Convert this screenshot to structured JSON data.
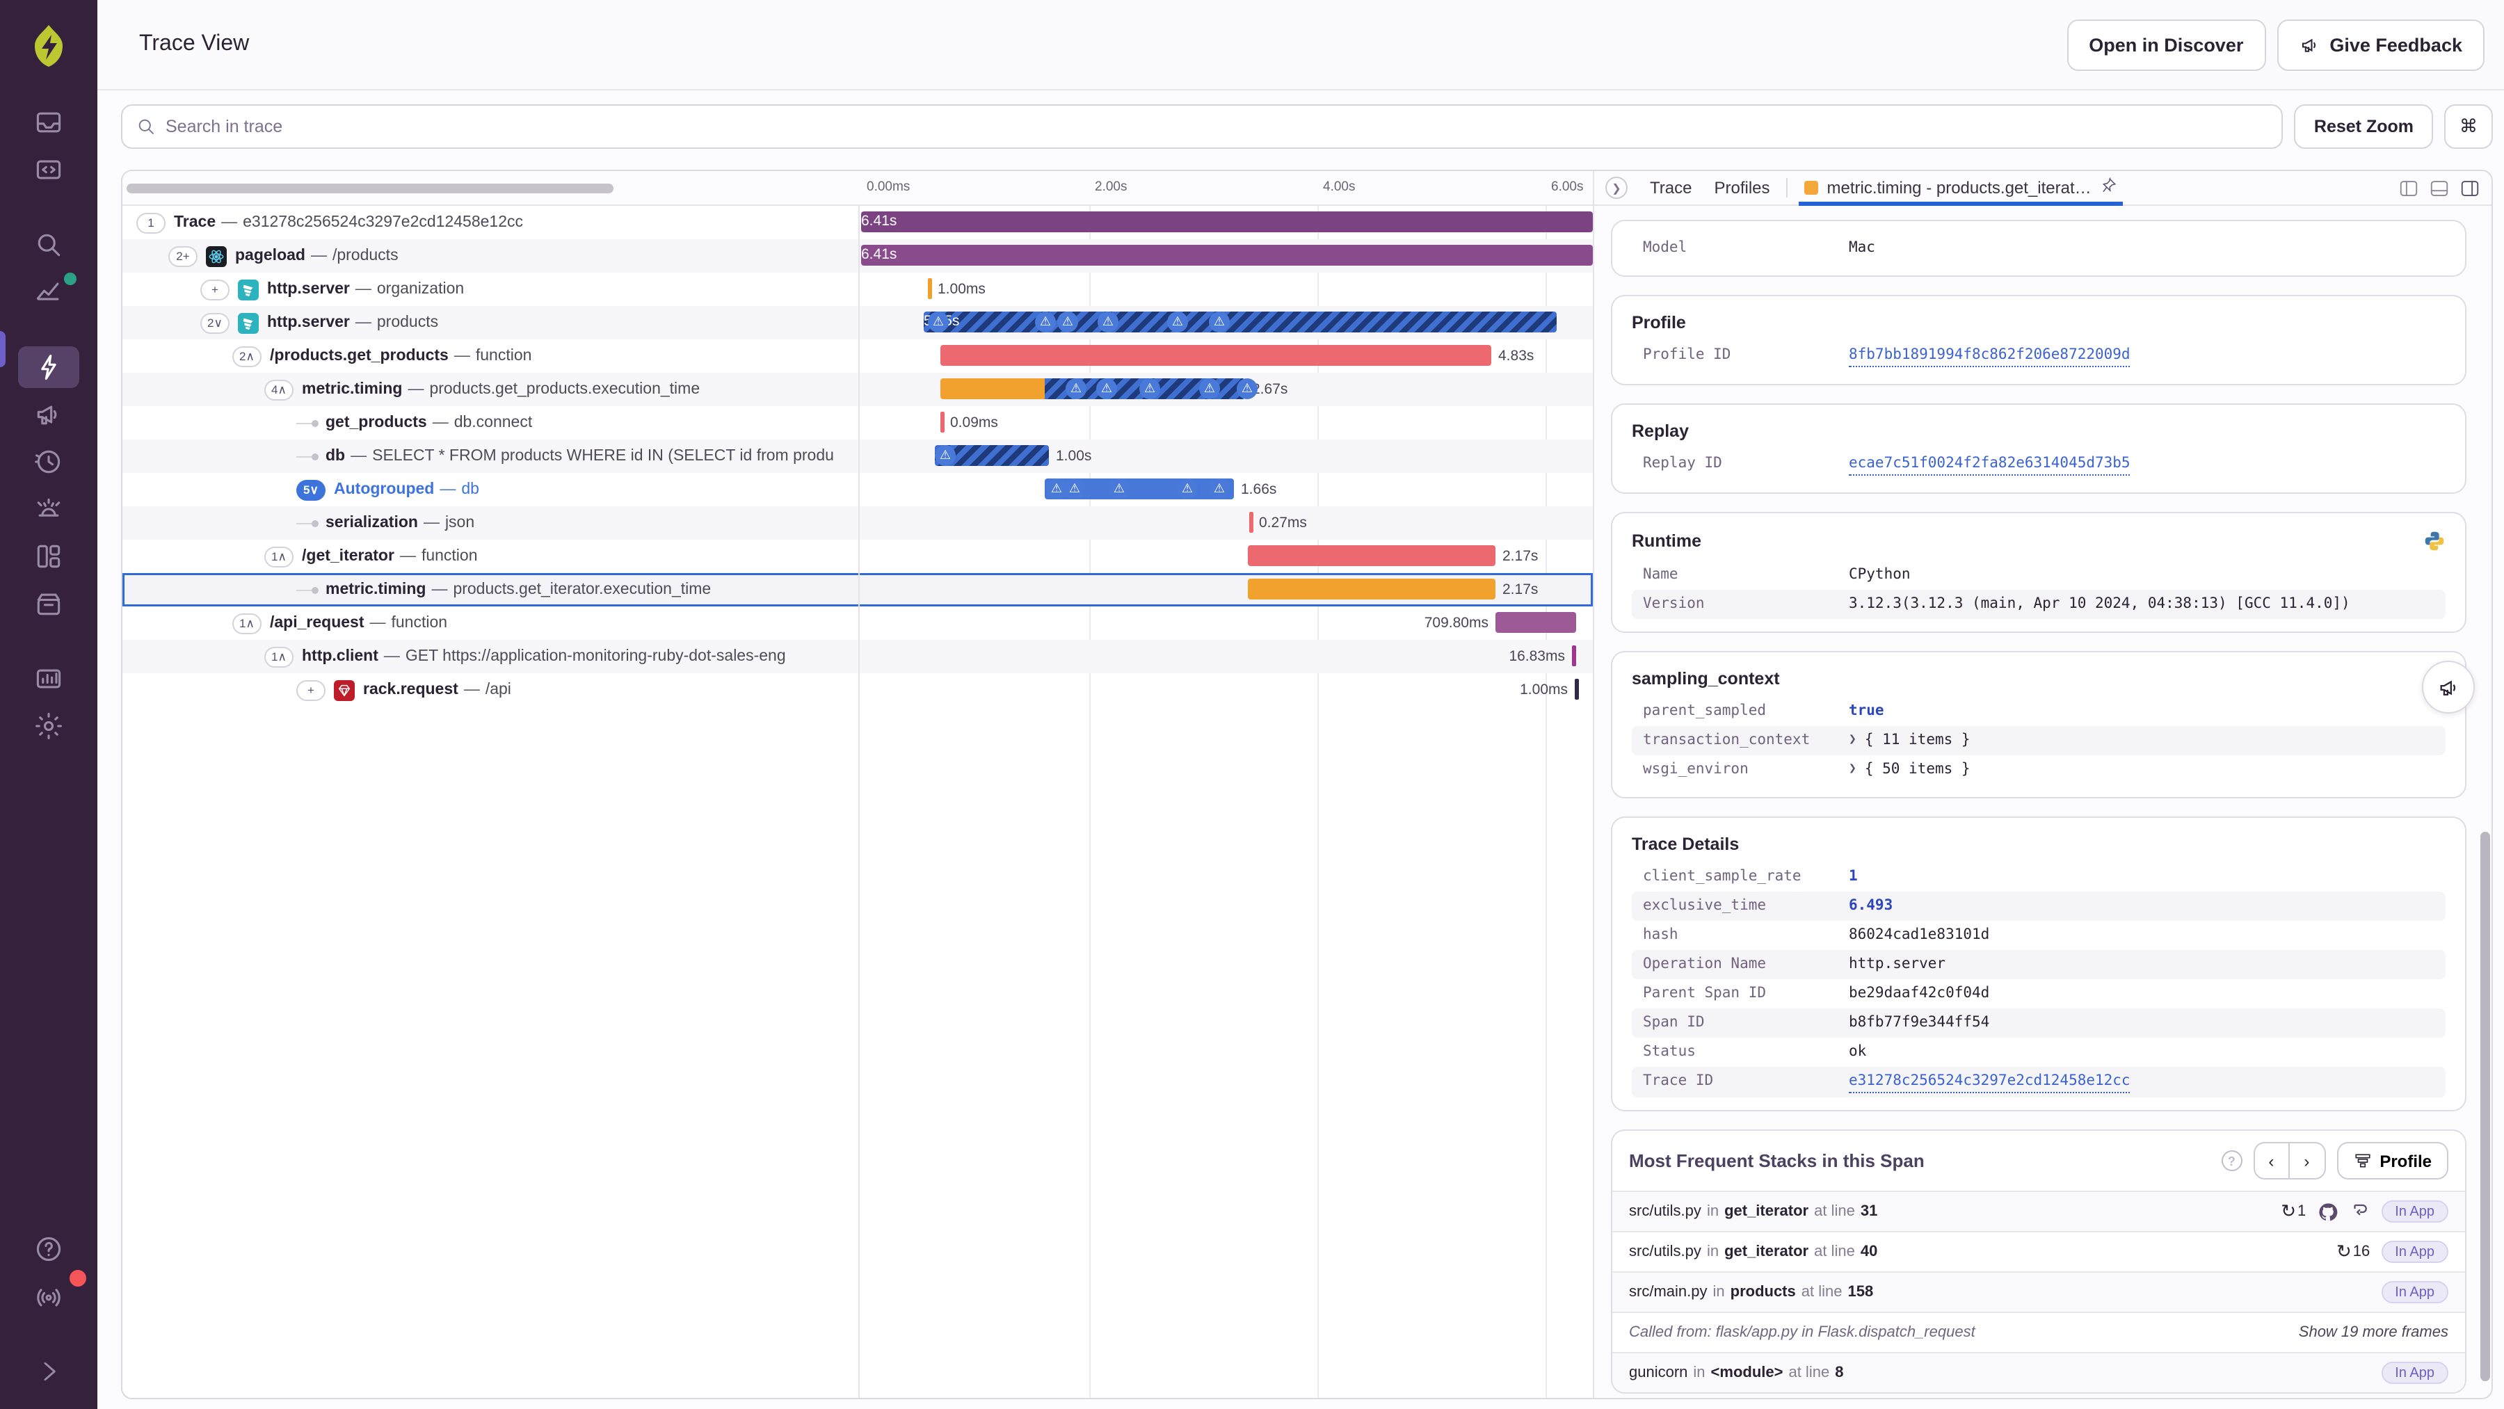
{
  "header": {
    "title": "Trace View",
    "buttons": [
      "Open in Discover",
      "Give Feedback"
    ]
  },
  "toolbar": {
    "search_placeholder": "Search in trace",
    "reset_zoom_label": "Reset Zoom",
    "shortcut_key": "⌘"
  },
  "sidebar": {
    "items": [
      "inbox",
      "code-folder",
      "search",
      "chart",
      "lightning",
      "megaphone",
      "history",
      "siren",
      "dashboard",
      "archive",
      "bar-chart",
      "gear",
      "help",
      "broadcast",
      "expand"
    ],
    "active": "lightning"
  },
  "tabs": {
    "items": [
      "Trace",
      "Profiles"
    ],
    "active": {
      "label": "metric.timing - products.get_iterat…"
    }
  },
  "trace": {
    "sep": "—",
    "timeline": {
      "ticks": [
        {
          "label": "0.00ms",
          "s": 0
        },
        {
          "label": "2.00s",
          "s": 2
        },
        {
          "label": "4.00s",
          "s": 4
        },
        {
          "label": "6.00s",
          "s": 6
        }
      ]
    },
    "spans": [
      {
        "op": "Trace",
        "desc": "e31278c256524c3297e2cd12458e12cc",
        "badge": "1",
        "depth": 0,
        "bar": {
          "type": "solid",
          "color": "#7c4382",
          "start": 0,
          "dur": 6.41,
          "label": "6.41s",
          "label_pos": "in"
        }
      },
      {
        "op": "pageload",
        "desc": "/products",
        "badge": "2+",
        "icon": "react",
        "depth": 1,
        "bar": {
          "type": "solid",
          "color": "#8a4b8d",
          "start": 0,
          "dur": 6.41,
          "label": "6.41s",
          "label_pos": "in"
        }
      },
      {
        "op": "http.server",
        "desc": "organization",
        "badge": "+",
        "icon": "flask",
        "depth": 2,
        "bar": {
          "type": "tick",
          "color": "#efa12a",
          "start": 0.58,
          "dur": 0.001,
          "label": "1.00ms",
          "label_pos": "right"
        }
      },
      {
        "op": "http.server",
        "desc": "products",
        "badge": "2∨",
        "icon": "flask",
        "depth": 2,
        "bar": {
          "type": "striped",
          "start": 0.55,
          "dur": 5.55,
          "label": "5.55s",
          "label_pos": "in",
          "warnings": [
            0.01,
            0.18,
            0.215,
            0.28,
            0.39,
            0.455
          ]
        }
      },
      {
        "op": "/products.get_products",
        "desc": "function",
        "badge": "2∧",
        "depth": 3,
        "bar": {
          "type": "solid",
          "color": "#ec6a6f",
          "start": 0.7,
          "dur": 4.83,
          "label": "4.83s",
          "label_pos": "right"
        }
      },
      {
        "op": "metric.timing",
        "desc": "products.get_products.execution_time",
        "badge": "4∧",
        "depth": 4,
        "bar": {
          "type": "split",
          "color": "#f0a12e",
          "start": 0.7,
          "dur": 2.67,
          "solid_dur": 0.92,
          "label": "2.67s",
          "label_pos": "right",
          "warnings": [
            0.42,
            0.52,
            0.66,
            0.86,
            0.98
          ]
        }
      },
      {
        "op": "get_products",
        "desc": "db.connect",
        "connector": true,
        "depth": 5,
        "bar": {
          "type": "tick",
          "color": "#ec6a6f",
          "start": 0.7,
          "dur": 0.0001,
          "label": "0.09ms",
          "label_pos": "right"
        }
      },
      {
        "op": "db",
        "desc": "SELECT * FROM products WHERE id IN (SELECT id from produ",
        "connector": true,
        "depth": 5,
        "bar": {
          "type": "striped",
          "start": 0.65,
          "dur": 1.0,
          "label": "1.00s",
          "label_pos": "right",
          "warnings": [
            0.02
          ]
        }
      },
      {
        "op": "Autogrouped",
        "desc": "db",
        "badge": "5∨",
        "badge_blue": true,
        "blue_text": true,
        "depth": 5,
        "bar": {
          "type": "solid",
          "color": "#4778d9",
          "start": 1.61,
          "dur": 1.66,
          "label": "1.66s",
          "label_pos": "right",
          "warnings": [
            0.02,
            0.12,
            0.35,
            0.71,
            0.88
          ]
        }
      },
      {
        "op": "serialization",
        "desc": "json",
        "connector": true,
        "depth": 5,
        "bar": {
          "type": "tick",
          "color": "#ec6a6f",
          "start": 3.4,
          "dur": 0.0003,
          "label": "0.27ms",
          "label_pos": "right"
        }
      },
      {
        "op": "/get_iterator",
        "desc": "function",
        "badge": "1∧",
        "depth": 4,
        "bar": {
          "type": "solid",
          "color": "#ec6a6f",
          "start": 3.39,
          "dur": 2.17,
          "label": "2.17s",
          "label_pos": "right"
        }
      },
      {
        "op": "metric.timing",
        "desc": "products.get_iterator.execution_time",
        "connector": true,
        "depth": 5,
        "selected": true,
        "bar": {
          "type": "solid",
          "color": "#f0a12e",
          "start": 3.39,
          "dur": 2.17,
          "label": "2.17s",
          "label_pos": "right"
        }
      },
      {
        "op": "/api_request",
        "desc": "function",
        "badge": "1∧",
        "depth": 3,
        "bar": {
          "type": "solid",
          "color": "#9c5a96",
          "start": 5.56,
          "dur": 0.7098,
          "label": "709.80ms",
          "label_pos": "left"
        }
      },
      {
        "op": "http.client",
        "desc": "GET https://application-monitoring-ruby-dot-sales-eng",
        "badge": "1∧",
        "depth": 4,
        "bar": {
          "type": "tick",
          "color": "#a1348c",
          "start": 6.23,
          "dur": 0.01683,
          "label": "16.83ms",
          "label_pos": "left"
        }
      },
      {
        "op": "rack.request",
        "desc": "/api",
        "badge": "+",
        "icon": "ruby",
        "depth": 5,
        "bar": {
          "type": "tick",
          "color": "#322a45",
          "start": 6.26,
          "dur": 0.001,
          "label": "1.00ms",
          "label_pos": "left"
        }
      }
    ]
  },
  "details": {
    "cards": [
      {
        "rows": [
          {
            "k": "Model",
            "v": "Mac"
          }
        ]
      },
      {
        "title": "Profile",
        "rows": [
          {
            "k": "Profile ID",
            "v": "8fb7bb1891994f8c862f206e8722009d",
            "link": true
          }
        ]
      },
      {
        "title": "Replay",
        "rows": [
          {
            "k": "Replay ID",
            "v": "ecae7c51f0024f2fa82e6314045d73b5",
            "link": true
          }
        ]
      },
      {
        "title": "Runtime",
        "icon": "python",
        "rows": [
          {
            "k": "Name",
            "v": "CPython"
          },
          {
            "k": "Version",
            "v": "3.12.3(3.12.3 (main, Apr 10 2024, 04:38:13) [GCC 11.4.0])",
            "alt": true
          }
        ]
      },
      {
        "title": "sampling_context",
        "rows": [
          {
            "k": "parent_sampled",
            "v": "true",
            "blue": true
          },
          {
            "k": "transaction_context",
            "v": "{ 11 items }",
            "expand": true,
            "alt": true
          },
          {
            "k": "wsgi_environ",
            "v": "{ 50 items }",
            "expand": true
          }
        ]
      },
      {
        "title": "Trace Details",
        "rows": [
          {
            "k": "client_sample_rate",
            "v": "1",
            "blue": true
          },
          {
            "k": "exclusive_time",
            "v": "6.493",
            "blue": true,
            "alt": true
          },
          {
            "k": "hash",
            "v": "86024cad1e83101d"
          },
          {
            "k": "Operation Name",
            "v": "http.server",
            "alt": true
          },
          {
            "k": "Parent Span ID",
            "v": "be29daaf42c0f04d"
          },
          {
            "k": "Span ID",
            "v": "b8fb77f9e344ff54",
            "alt": true
          },
          {
            "k": "Status",
            "v": "ok"
          },
          {
            "k": "Trace ID",
            "v": "e31278c256524c3297e2cd12458e12cc",
            "link": true,
            "alt": true
          }
        ]
      }
    ]
  },
  "stacks": {
    "title": "Most Frequent Stacks in this Span",
    "profile_label": "Profile",
    "in_app_label": "In App",
    "frames": [
      {
        "file": "src/utils.py",
        "func": "get_iterator",
        "line": "31",
        "repeat": "1",
        "icons": [
          "github",
          "hook"
        ],
        "in_app": true
      },
      {
        "file": "src/utils.py",
        "func": "get_iterator",
        "line": "40",
        "repeat": "16",
        "in_app": true
      },
      {
        "file": "src/main.py",
        "func": "products",
        "line": "158",
        "in_app": true
      },
      {
        "called_from": "Called from: flask/app.py in Flask.dispatch_request",
        "more": "Show 19 more frames"
      },
      {
        "file": "gunicorn",
        "func": "<module>",
        "line": "8",
        "in_app": true
      }
    ]
  }
}
